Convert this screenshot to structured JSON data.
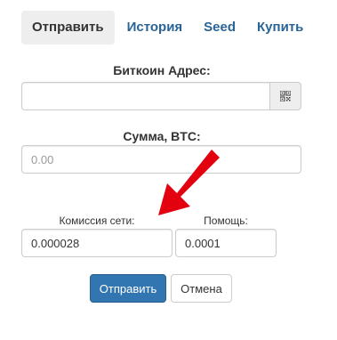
{
  "tabs": [
    {
      "label": "Отправить",
      "active": true
    },
    {
      "label": "История",
      "active": false
    },
    {
      "label": "Seed",
      "active": false
    },
    {
      "label": "Купить",
      "active": false
    }
  ],
  "form": {
    "address_label": "Биткоин Адрес:",
    "address_value": "",
    "qr_icon": "qr-code-icon",
    "amount_label": "Сумма, BTC:",
    "amount_placeholder": "0.00",
    "fee_label": "Комиссия сети:",
    "fee_value": "0.000028",
    "help_label": "Помощь:",
    "help_value": "0.0001"
  },
  "buttons": {
    "send_label": "Отправить",
    "cancel_label": "Отмена"
  },
  "colors": {
    "primary": "#3276b1",
    "link": "#2a6496",
    "arrow": "#e3000f"
  }
}
